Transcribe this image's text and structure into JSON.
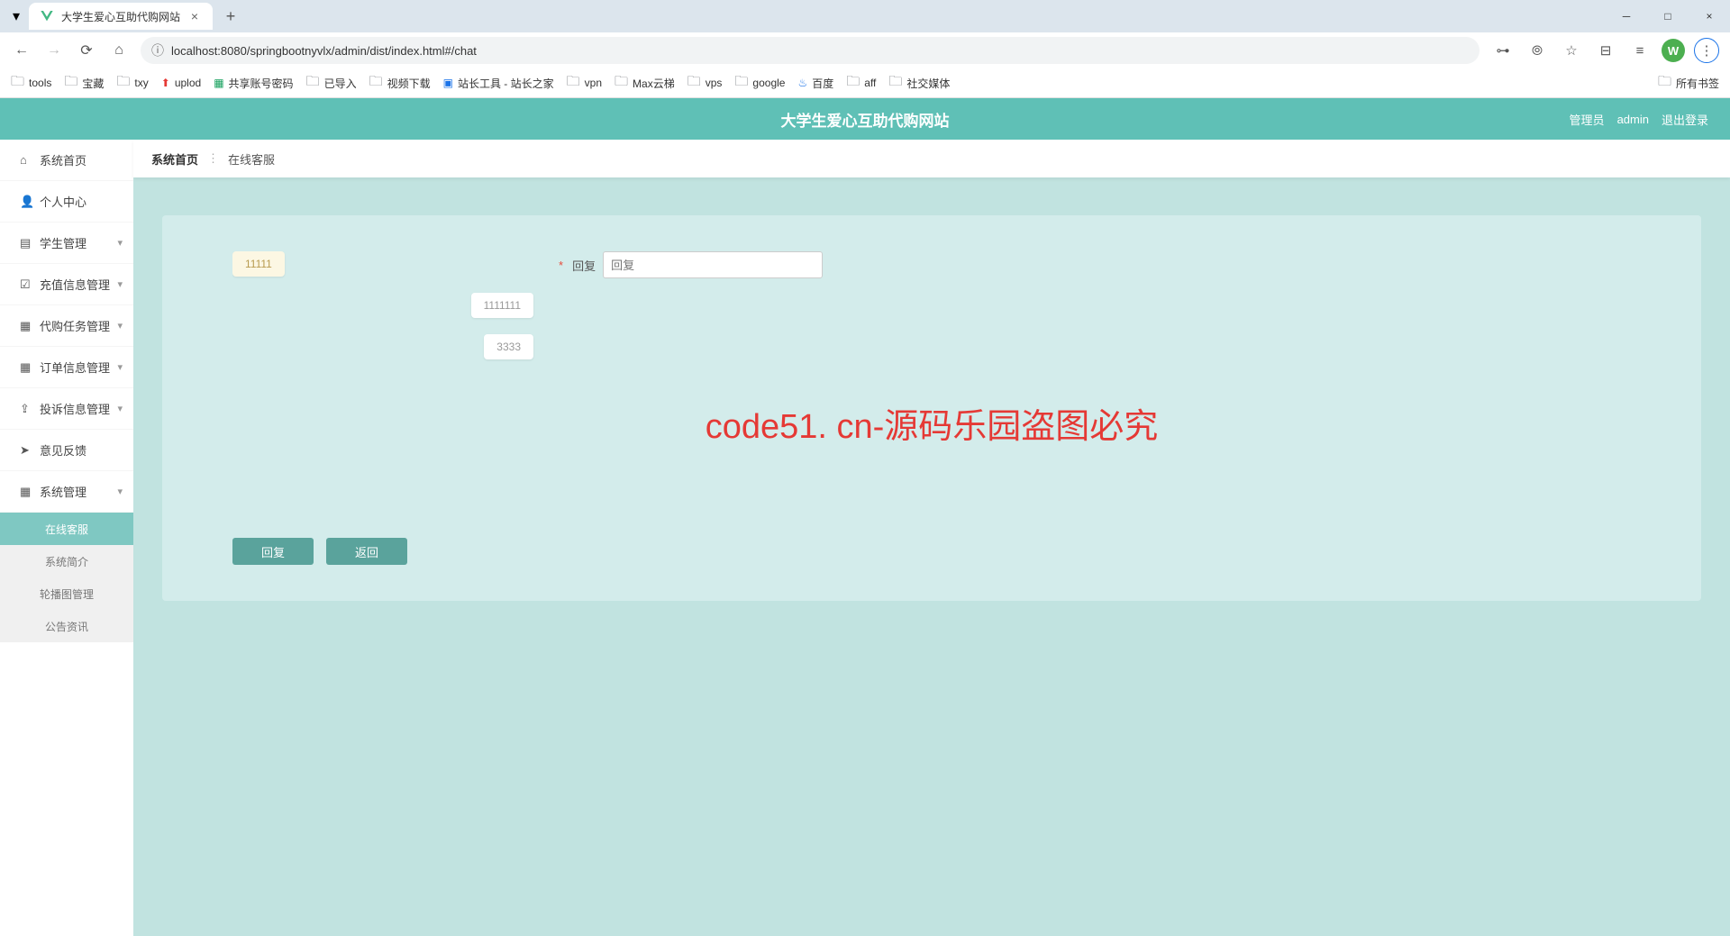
{
  "browser": {
    "tab_title": "大学生爱心互助代购网站",
    "url": "localhost:8080/springbootnyvlx/admin/dist/index.html#/chat",
    "bookmarks": [
      "tools",
      "宝藏",
      "txy",
      "uplod",
      "共享账号密码",
      "已导入",
      "视频下载",
      "站长工具 - 站长之家",
      "vpn",
      "Max云梯",
      "vps",
      "google",
      "百度",
      "aff",
      "社交媒体"
    ],
    "all_bookmarks": "所有书签"
  },
  "header": {
    "title": "大学生爱心互助代购网站",
    "role": "管理员",
    "username": "admin",
    "logout": "退出登录"
  },
  "sidebar": {
    "items": [
      {
        "label": "系统首页",
        "icon": "home"
      },
      {
        "label": "个人中心",
        "icon": "user"
      },
      {
        "label": "学生管理",
        "icon": "doc",
        "expandable": true
      },
      {
        "label": "充值信息管理",
        "icon": "check",
        "expandable": true
      },
      {
        "label": "代购任务管理",
        "icon": "grid",
        "expandable": true
      },
      {
        "label": "订单信息管理",
        "icon": "grid",
        "expandable": true
      },
      {
        "label": "投诉信息管理",
        "icon": "upload",
        "expandable": true
      },
      {
        "label": "意见反馈",
        "icon": "send"
      },
      {
        "label": "系统管理",
        "icon": "grid",
        "expandable": true
      }
    ],
    "subitems": [
      "在线客服",
      "系统简介",
      "轮播图管理",
      "公告资讯"
    ]
  },
  "breadcrumb": {
    "home": "系统首页",
    "current": "在线客服"
  },
  "chat": {
    "messages": [
      {
        "side": "left",
        "text": "11111"
      },
      {
        "side": "right",
        "text": "1111111"
      },
      {
        "side": "right",
        "text": "3333"
      }
    ],
    "reply_label": "回复",
    "reply_placeholder": "回复",
    "btn_reply": "回复",
    "btn_back": "返回"
  },
  "watermark": "code51. cn-源码乐园盗图必究"
}
